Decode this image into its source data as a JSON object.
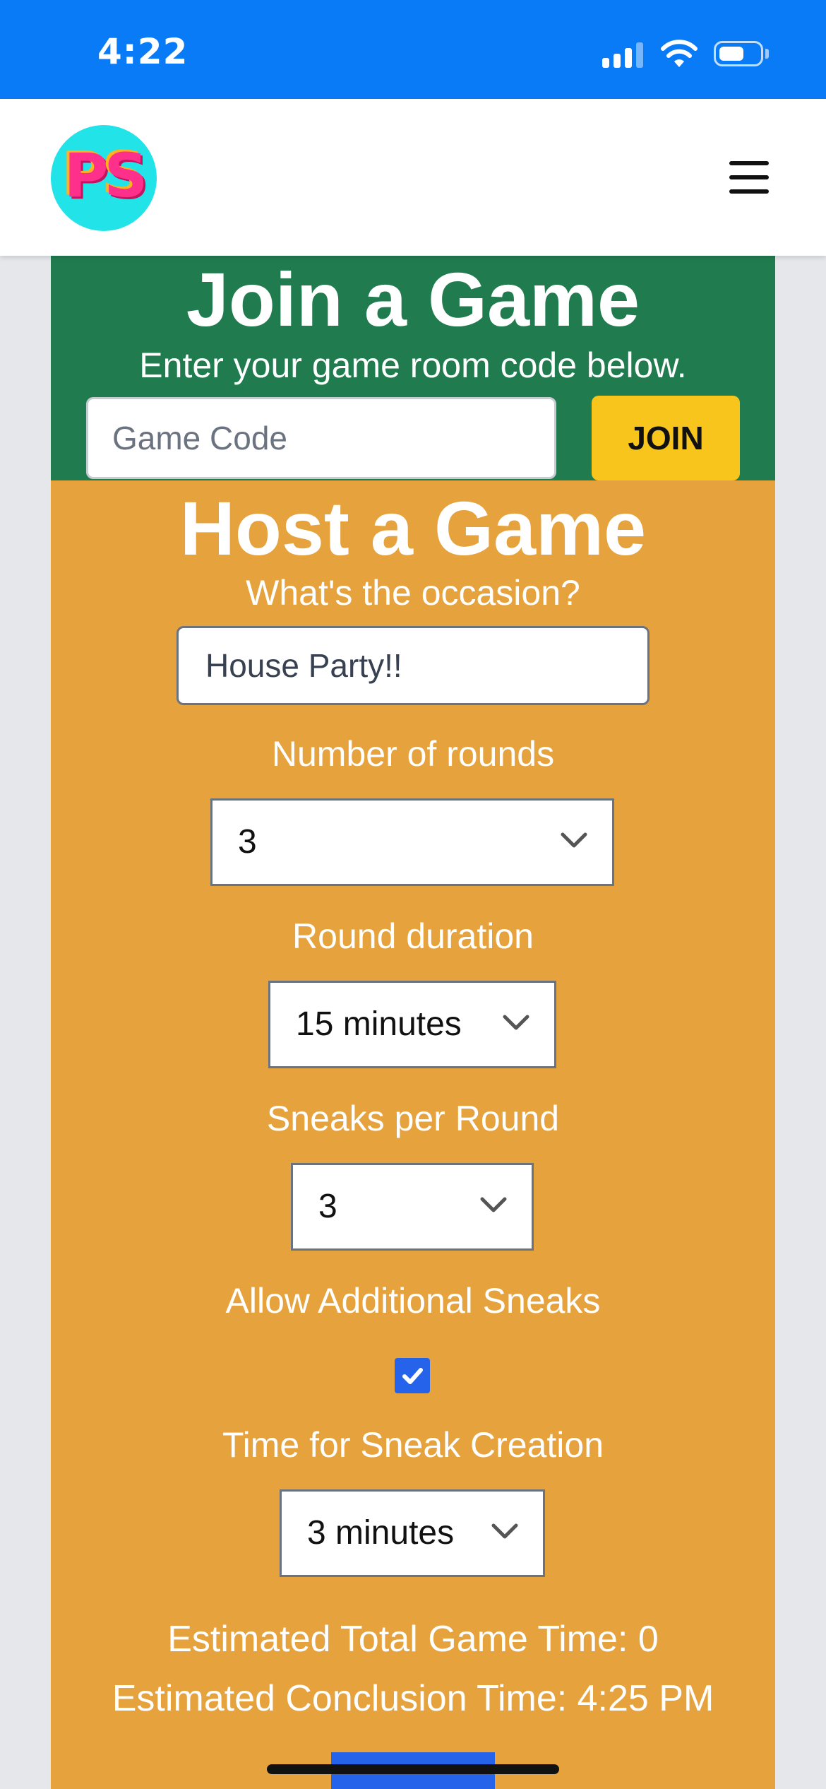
{
  "status_bar": {
    "time": "4:22"
  },
  "navbar": {
    "logo_text": "PS",
    "menu_icon": "hamburger-menu-icon"
  },
  "join": {
    "title": "Join a Game",
    "subtitle": "Enter your game room code below.",
    "code_placeholder": "Game Code",
    "code_value": "",
    "button_label": "JOIN"
  },
  "host": {
    "title": "Host a Game",
    "occasion_label": "What's the occasion?",
    "occasion_value": "House Party!!",
    "rounds_label": "Number of rounds",
    "rounds_value": "3",
    "duration_label": "Round duration",
    "duration_value": "15 minutes",
    "sneaks_label": "Sneaks per Round",
    "sneaks_value": "3",
    "additional_label": "Allow Additional Sneaks",
    "additional_checked": true,
    "creation_label": "Time for Sneak Creation",
    "creation_value": "3 minutes",
    "estimated_total": "Estimated Total Game Time: 0",
    "estimated_conclusion": "Estimated Conclusion Time: 4:25 PM"
  },
  "colors": {
    "status_bar": "#0a7bf7",
    "join_bg": "#207c4f",
    "host_bg": "#e5a23d",
    "join_button": "#f7c51c",
    "checkbox": "#2563eb"
  }
}
